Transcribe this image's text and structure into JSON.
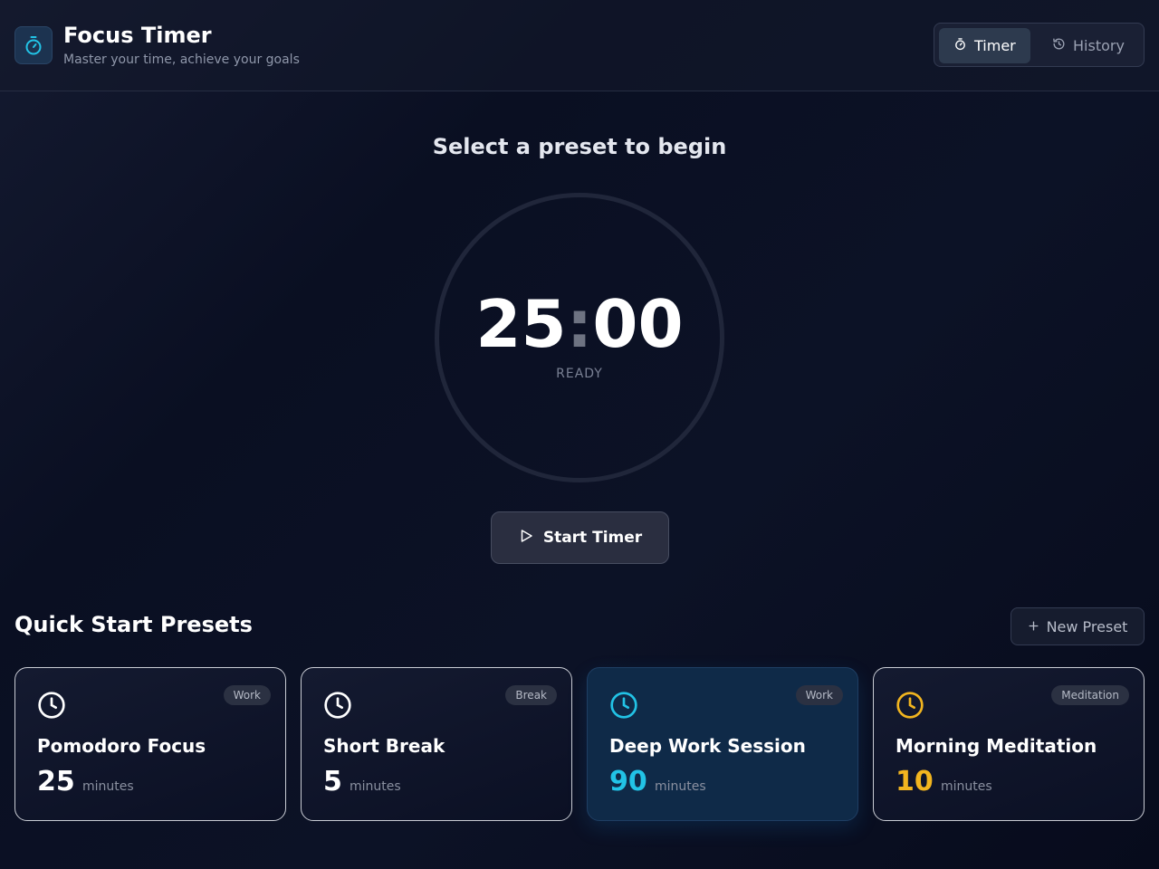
{
  "app": {
    "title": "Focus Timer",
    "subtitle": "Master your time, achieve your goals"
  },
  "nav": {
    "tabs": [
      {
        "label": "Timer",
        "icon": "stopwatch-icon",
        "active": true
      },
      {
        "label": "History",
        "icon": "history-icon",
        "active": false
      }
    ]
  },
  "timer": {
    "prompt": "Select a preset to begin",
    "minutes": "25",
    "separator": ":",
    "seconds": "00",
    "status": "READY",
    "start_label": "Start Timer",
    "start_icon": "play-icon"
  },
  "presets": {
    "title": "Quick Start Presets",
    "new_label": "New Preset",
    "new_icon": "plus-icon",
    "unit": "minutes",
    "items": [
      {
        "name": "Pomodoro Focus",
        "category": "Work",
        "duration": "25",
        "icon": "clock-icon",
        "color": "#ffffff",
        "selected": false
      },
      {
        "name": "Short Break",
        "category": "Break",
        "duration": "5",
        "icon": "clock-icon",
        "color": "#ffffff",
        "selected": false
      },
      {
        "name": "Deep Work Session",
        "category": "Work",
        "duration": "90",
        "icon": "clock-icon",
        "color": "#22c3e6",
        "selected": true
      },
      {
        "name": "Morning Meditation",
        "category": "Meditation",
        "duration": "10",
        "icon": "clock-icon",
        "color": "#f2b51f",
        "selected": false
      }
    ]
  },
  "colors": {
    "accent": "#22c3e6",
    "meditation": "#f2b51f",
    "background": "#0a0f22"
  }
}
